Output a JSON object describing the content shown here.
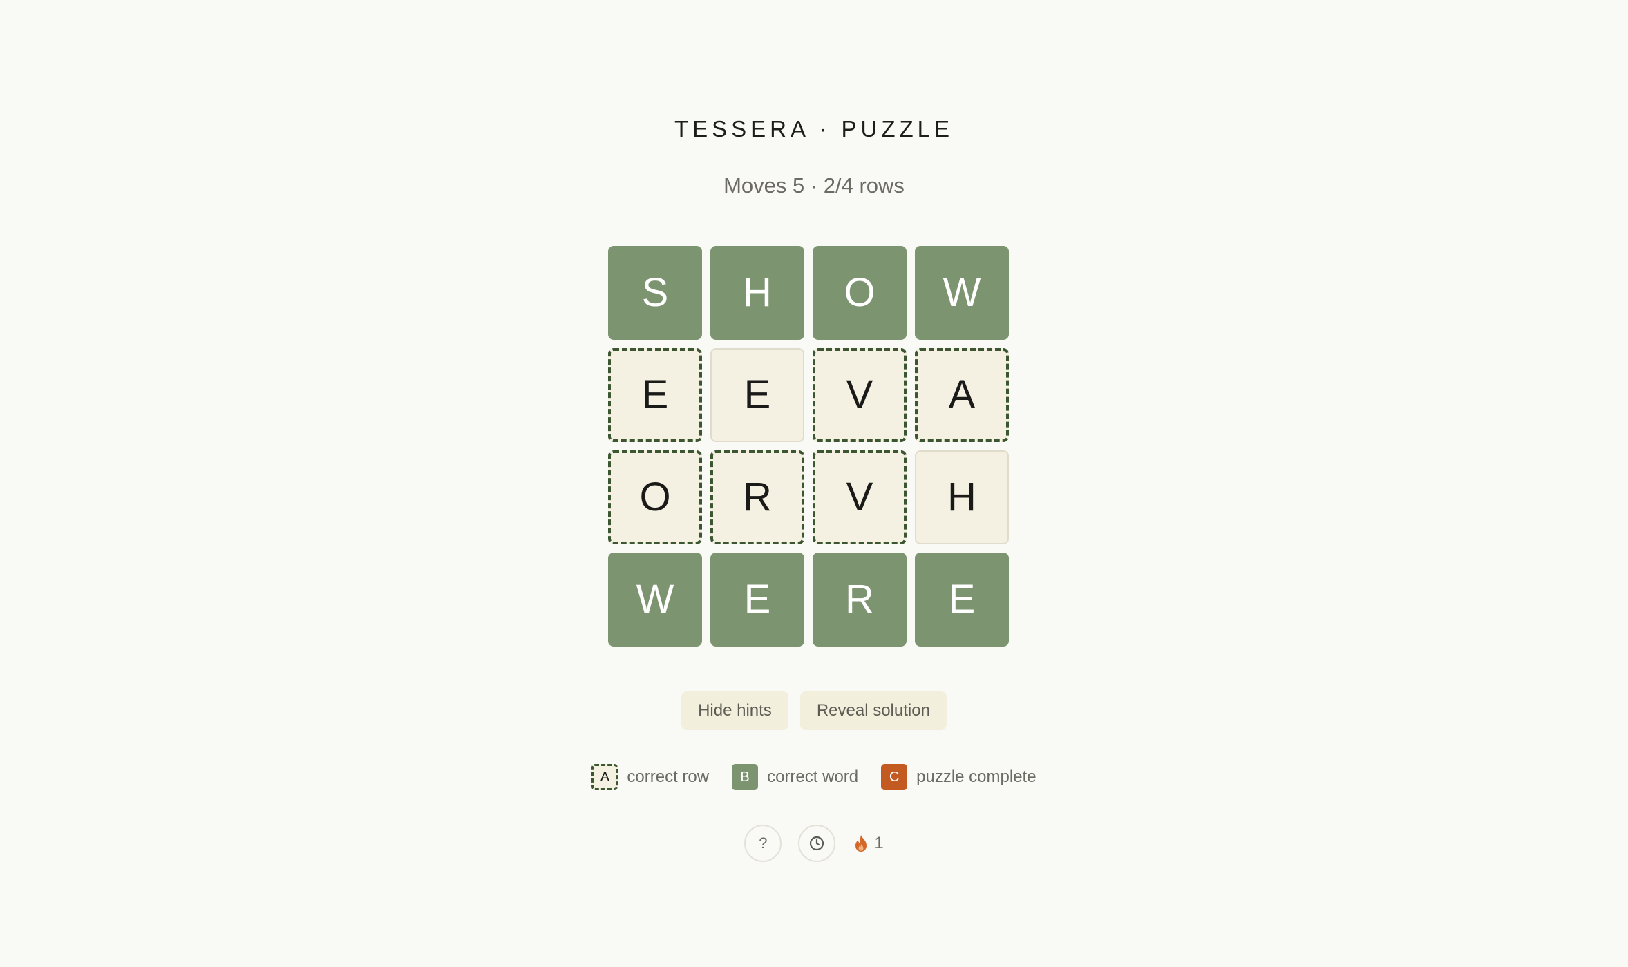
{
  "header": {
    "title": "TESSERA · PUZZLE",
    "status": "Moves 5 · 2/4 rows"
  },
  "board": {
    "rows": [
      [
        {
          "letter": "S",
          "state": "solved"
        },
        {
          "letter": "H",
          "state": "solved"
        },
        {
          "letter": "O",
          "state": "solved"
        },
        {
          "letter": "W",
          "state": "solved"
        }
      ],
      [
        {
          "letter": "E",
          "state": "rowok"
        },
        {
          "letter": "E",
          "state": "plain"
        },
        {
          "letter": "V",
          "state": "rowok"
        },
        {
          "letter": "A",
          "state": "rowok"
        }
      ],
      [
        {
          "letter": "O",
          "state": "rowok"
        },
        {
          "letter": "R",
          "state": "rowok"
        },
        {
          "letter": "V",
          "state": "rowok"
        },
        {
          "letter": "H",
          "state": "plain"
        }
      ],
      [
        {
          "letter": "W",
          "state": "solved"
        },
        {
          "letter": "E",
          "state": "solved"
        },
        {
          "letter": "R",
          "state": "solved"
        },
        {
          "letter": "E",
          "state": "solved"
        }
      ]
    ]
  },
  "actions": {
    "hide_hints": "Hide hints",
    "reveal_solution": "Reveal solution"
  },
  "legend": {
    "row": {
      "swatch": "A",
      "label": "correct row"
    },
    "word": {
      "swatch": "B",
      "label": "correct word"
    },
    "complete": {
      "swatch": "C",
      "label": "puzzle complete"
    }
  },
  "footer": {
    "help_label": "?",
    "help_icon": "question-icon",
    "history_icon": "clock-icon",
    "streak_icon": "flame-icon",
    "streak_count": "1"
  },
  "colors": {
    "background": "#f9f9f5",
    "solved_tile": "#7d9471",
    "hint_tile": "#f5f1e2",
    "row_border": "#3b5630",
    "complete": "#c35a22",
    "flame": "#d4682a"
  }
}
